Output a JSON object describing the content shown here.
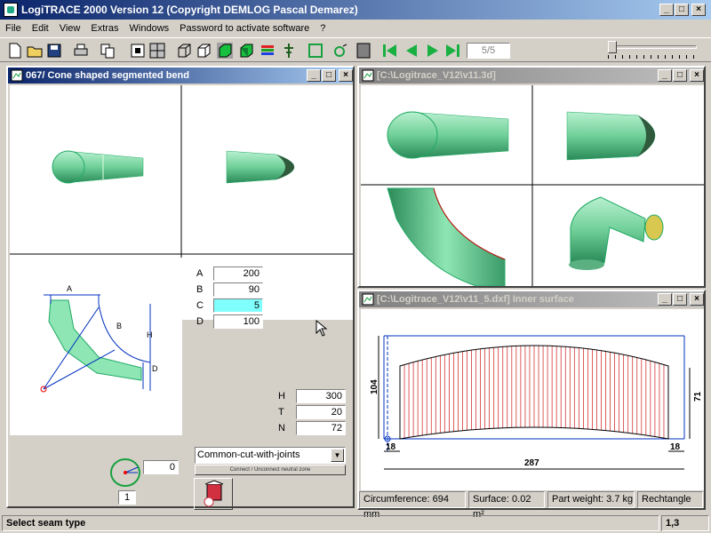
{
  "app": {
    "title": "LogiTRACE 2000  Version 12  (Copyright DEMLOG Pascal Demarez)"
  },
  "menu": [
    "File",
    "Edit",
    "View",
    "Extras",
    "Windows",
    "Password to activate software",
    "?"
  ],
  "toolbar": {
    "page": "5/5"
  },
  "colors": {
    "accent": "#0a246a",
    "part": "#7ed9a6",
    "highlight": "#80ffff",
    "cut_lines": "#d01818"
  },
  "left_window": {
    "title": "067/ Cone shaped segmented bend",
    "sketch_labels": {
      "a": "A",
      "b": "B",
      "h": "H",
      "d": "D"
    },
    "params": [
      {
        "label": "A",
        "value": "200"
      },
      {
        "label": "B",
        "value": "90"
      },
      {
        "label": "C",
        "value": "5"
      },
      {
        "label": "D",
        "value": "100"
      }
    ],
    "params2": [
      {
        "label": "H",
        "value": "300"
      },
      {
        "label": "T",
        "value": "20"
      },
      {
        "label": "N",
        "value": "72"
      }
    ],
    "angle_value": "0",
    "count_value": "1",
    "seam_select": "Common-cut-with-joints",
    "seam_button": "Connect / Unconnect neutral zone"
  },
  "right_top_window": {
    "title": "[C:\\Logitrace_V12\\v11.3d]"
  },
  "right_bottom_window": {
    "title": "[C:\\Logitrace_V12\\v11_5.dxf]  Inner surface",
    "dims": {
      "left_height": "104",
      "right_height": "71",
      "left_off": "18",
      "right_off": "18",
      "width": "287"
    },
    "info": {
      "circumference": "Circumference: 694 mm",
      "surface": "Surface: 0.02 m²",
      "weight": "Part weight: 3.7 kg",
      "shape": "Rechtangle"
    }
  },
  "status": {
    "message": "Select seam type",
    "position": "1,3"
  }
}
